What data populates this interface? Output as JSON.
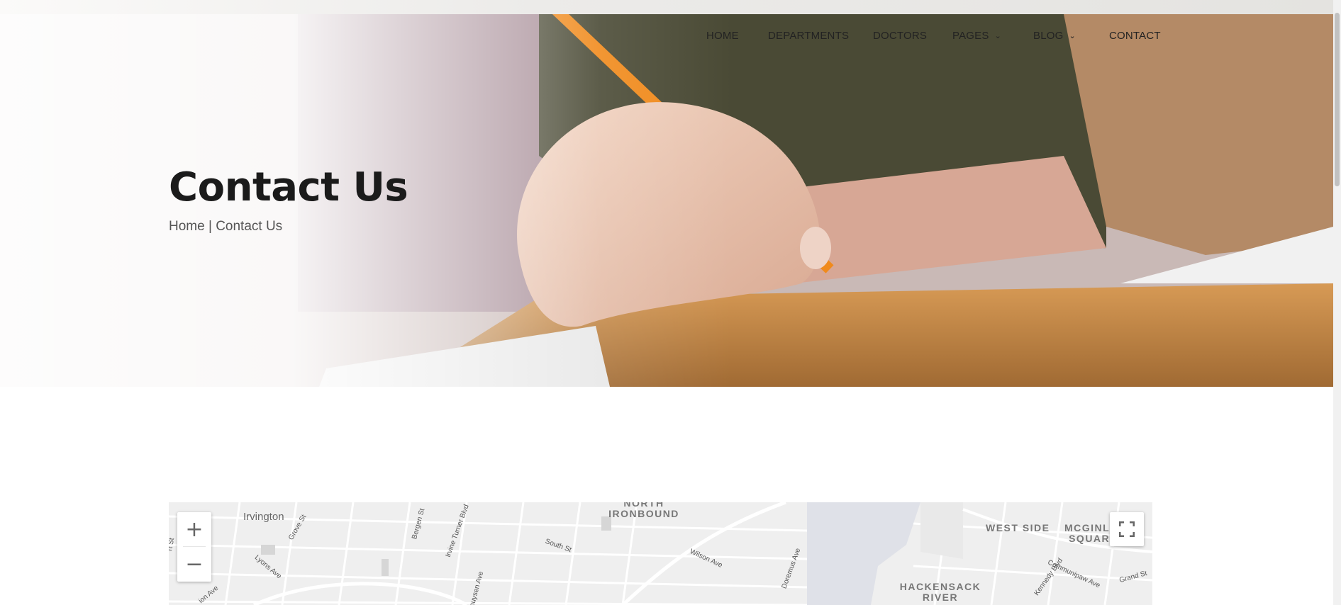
{
  "nav": {
    "items": [
      {
        "label": "HOME"
      },
      {
        "label": "DEPARTMENTS"
      },
      {
        "label": "DOCTORS"
      },
      {
        "label": "PAGES"
      },
      {
        "label": "BLOG"
      },
      {
        "label": "CONTACT"
      }
    ],
    "dropdown_icon": "chevron-down-icon"
  },
  "hero": {
    "title": "Contact Us",
    "breadcrumb": {
      "home": "Home",
      "separator": "|",
      "current": "Contact Us"
    }
  },
  "map": {
    "zoom_in": "+",
    "zoom_out": "−",
    "fullscreen_icon": "fullscreen-icon",
    "labels": {
      "irvington": "Irvington",
      "north_ironbound_1": "NORTH",
      "north_ironbound_2": "IRONBOUND",
      "west_side": "WEST SIDE",
      "mcginley_1": "MCGINLE",
      "mcginley_2": "SQUARE",
      "hackensack_1": "HACKENSACK",
      "hackensack_2": "RIVER",
      "grove_st": "Grove St",
      "bergen_st": "Bergen St",
      "irvine_turner": "Irvine Turner Blvd",
      "south_st": "South St",
      "wilson_ave": "Wilson Ave",
      "doremus_ave": "Doremus Ave",
      "lyons_ave": "Lyons Ave",
      "chancellor_ave": "ion Ave",
      "van_duyne": "uhuysen Ave",
      "kennedy_blvd": "Kennedy Blvd",
      "communipaw": "Communipaw Ave",
      "grand_st": "Grand St",
      "st_edge": "rt St"
    }
  },
  "colors": {
    "title": "#1b1b1b",
    "nav": "#222222",
    "breadcrumb": "#555555"
  }
}
